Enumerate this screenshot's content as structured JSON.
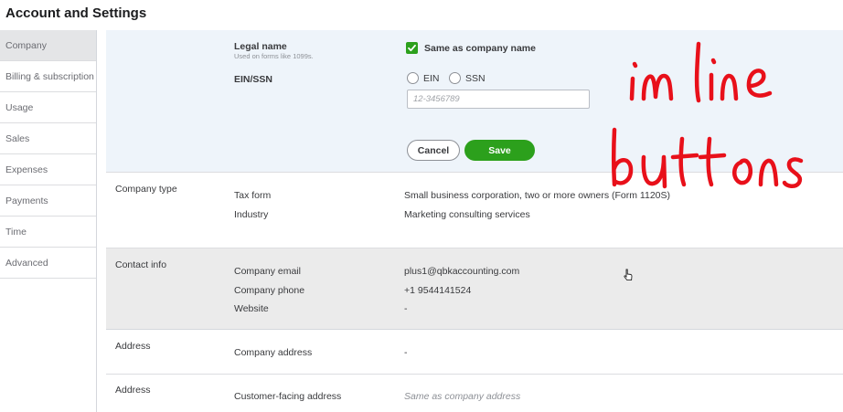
{
  "header": {
    "title": "Account and Settings"
  },
  "sidebar": {
    "items": [
      {
        "label": "Company",
        "active": true
      },
      {
        "label": "Billing & subscription"
      },
      {
        "label": "Usage"
      },
      {
        "label": "Sales"
      },
      {
        "label": "Expenses"
      },
      {
        "label": "Payments"
      },
      {
        "label": "Time"
      },
      {
        "label": "Advanced"
      }
    ]
  },
  "legal_section": {
    "legal_name_label": "Legal name",
    "legal_name_hint": "Used on forms like 1099s.",
    "same_as_company_label": "Same as company name",
    "same_as_company_checked": true,
    "ein_ssn_label": "EIN/SSN",
    "ein_option": "EIN",
    "ssn_option": "SSN",
    "ein_placeholder": "12-3456789",
    "cancel_label": "Cancel",
    "save_label": "Save"
  },
  "company_type": {
    "section_label": "Company type",
    "tax_form_label": "Tax form",
    "tax_form_value": "Small business corporation, two or more owners (Form 1120S)",
    "industry_label": "Industry",
    "industry_value": "Marketing consulting services"
  },
  "contact_info": {
    "section_label": "Contact info",
    "email_label": "Company email",
    "email_value": "plus1@qbkaccounting.com",
    "phone_label": "Company phone",
    "phone_value": "+1 9544141524",
    "website_label": "Website",
    "website_value": "-"
  },
  "address": {
    "section_label": "Address",
    "company_address_label": "Company address",
    "company_address_value": "-"
  },
  "customer_address": {
    "section_label": "Address",
    "customer_facing_label": "Customer-facing address",
    "customer_facing_value": "Same as company address"
  },
  "colors": {
    "brand_green": "#2ca01c",
    "annotation_red": "#e8101a",
    "legal_section_bg": "#eef4fa",
    "contact_section_bg": "#ebebeb"
  }
}
